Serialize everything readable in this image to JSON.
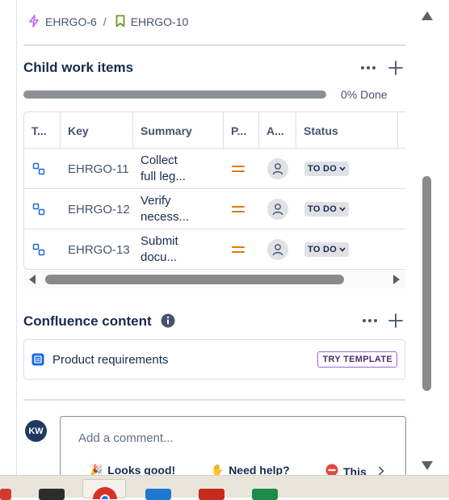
{
  "breadcrumb": {
    "parent_key": "EHRGO-6",
    "separator": "/",
    "current_key": "EHRGO-10"
  },
  "child_work_items": {
    "title": "Child work items",
    "progress_percent": 0,
    "progress_label": "0% Done",
    "columns": {
      "type": "T...",
      "key": "Key",
      "summary": "Summary",
      "priority": "P...",
      "assignee": "A...",
      "status": "Status"
    },
    "rows": [
      {
        "key": "EHRGO-11",
        "summary": "Collect\nfull leg...",
        "status": "TO DO"
      },
      {
        "key": "EHRGO-12",
        "summary": "Verify\nnecess...",
        "status": "TO DO"
      },
      {
        "key": "EHRGO-13",
        "summary": "Submit\ndocu...",
        "status": "TO DO"
      }
    ]
  },
  "confluence": {
    "title": "Confluence content",
    "page_title": "Product requirements",
    "try_template_label": "TRY TEMPLATE"
  },
  "comment": {
    "avatar_initials": "KW",
    "placeholder": "Add a comment...",
    "quick_replies": [
      "Looks good!",
      "Need help?",
      "This"
    ]
  },
  "colors": {
    "progress_fill": "#22a06b",
    "priority_medium": "#e2780d",
    "subtask_icon": "#1868db",
    "parent_icon": "#bf63f3",
    "bookmark_icon": "#6a9a23"
  },
  "icons": {
    "parent": "lightning-icon",
    "current": "bookmark-icon",
    "more": "more-icon",
    "add": "plus-icon",
    "info": "info-icon",
    "page": "page-icon"
  }
}
